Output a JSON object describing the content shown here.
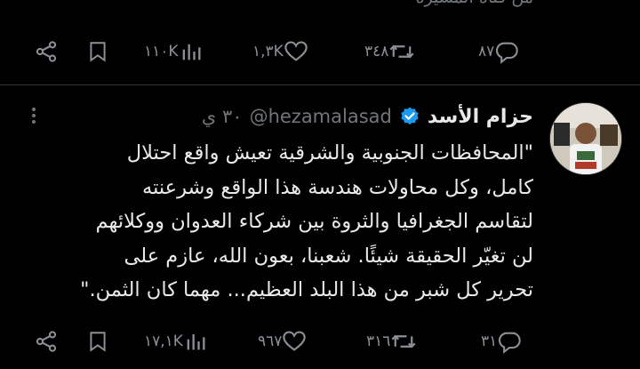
{
  "previous_tweet": {
    "text_fragment": "من قناة المسيرة",
    "actions": {
      "replies": "٨٧",
      "reposts": "٣٤٨",
      "likes": "١,٣K",
      "views": "١١٠K"
    }
  },
  "tweet": {
    "display_name": "حزام الأسد",
    "verified": true,
    "handle": "@hezamalasad",
    "time": "٣٠ ي",
    "lines": [
      "\"المحافظات الجنوبية والشرقية تعيش واقع احتلال",
      "كامل، وكل محاولات هندسة هذا الواقع وشرعنته",
      "لتقاسم الجغرافيا والثروة بين شركاء العدوان ووكلائهم",
      "لن تغيّر الحقيقة شيئًا. شعبنا، بعون الله، عازم على",
      "تحرير كل شبر من هذا البلد العظيم... مهما كان الثمن.\""
    ],
    "actions": {
      "replies": "٣١",
      "reposts": "٣١٦",
      "likes": "٩٦٧",
      "views": "١٧,١K"
    }
  },
  "colors": {
    "background": "#000000",
    "text": "#e7e9ea",
    "secondary": "#71767b",
    "verified": "#1d9bf0",
    "divider": "#2f3336"
  },
  "icons": [
    "share-icon",
    "bookmark-icon",
    "views-icon",
    "like-icon",
    "repost-icon",
    "reply-icon",
    "verified-icon",
    "more-icon"
  ]
}
